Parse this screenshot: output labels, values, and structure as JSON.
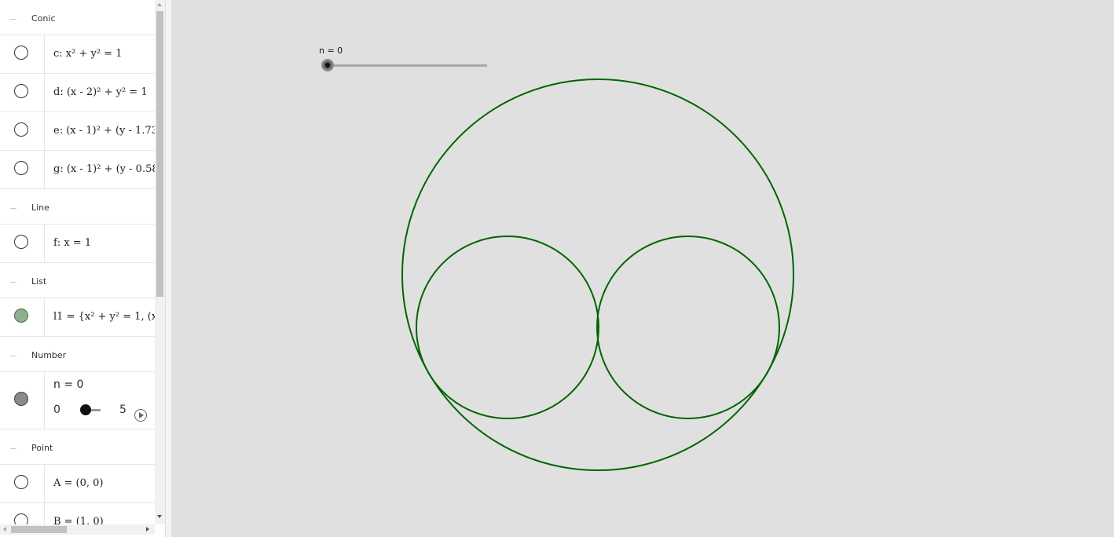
{
  "algebra": {
    "groups": [
      {
        "title": "Conic",
        "items": [
          {
            "formula": "c: x² + y² = 1"
          },
          {
            "formula": "d: (x - 2)² + y² = 1"
          },
          {
            "formula": "e: (x - 1)² + (y - 1.73"
          },
          {
            "formula": "g: (x - 1)² + (y - 0.58"
          }
        ]
      },
      {
        "title": "Line",
        "items": [
          {
            "formula": "f: x = 1"
          }
        ]
      },
      {
        "title": "List",
        "items": [
          {
            "formula": "l1 = {x² + y² = 1, (x"
          }
        ]
      },
      {
        "title": "Number",
        "items": [
          {
            "formula": "n = 0",
            "slider_min": "0",
            "slider_max": "5",
            "slider_value": 0
          }
        ]
      },
      {
        "title": "Point",
        "items": [
          {
            "formula": "A = (0, 0)"
          },
          {
            "formula": "B = (1, 0)"
          }
        ]
      }
    ]
  },
  "graphics": {
    "slider_label": "n = 0",
    "slider_value": 0,
    "circle_color": "#006400",
    "background": "#e0e0e0"
  }
}
